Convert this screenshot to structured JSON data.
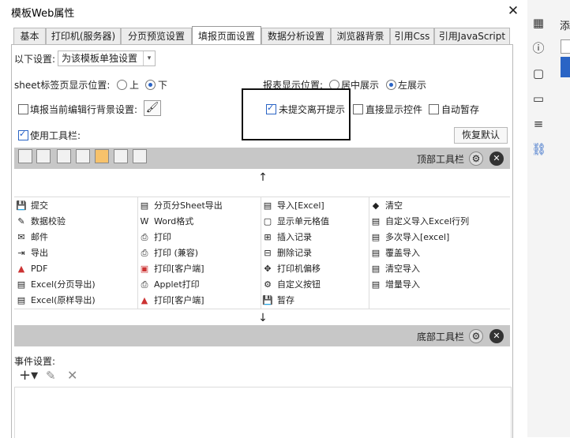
{
  "window": {
    "title": "模板Web属性"
  },
  "tabs": [
    "基本",
    "打印机(服务器)",
    "分页预览设置",
    "填报页面设置",
    "数据分析设置",
    "浏览器背景",
    "引用Css",
    "引用JavaScript"
  ],
  "settings": {
    "scope_label": "以下设置:",
    "scope_value": "为该模板单独设置",
    "sheet_pos_label": "sheet标签页显示位置:",
    "sheet_pos_top": "上",
    "sheet_pos_bottom": "下",
    "report_pos_label": "报表显示位置:",
    "report_pos_center": "居中展示",
    "report_pos_left": "左展示",
    "fill_bg_label": "填报当前编辑行背景设置:",
    "unsubmitted_label": "未提交离开提示",
    "direct_ctrl_label": "直接显示控件",
    "autosave_label": "自动暂存",
    "use_toolbar_label": "使用工具栏:",
    "restore_default": "恢复默认"
  },
  "top_toolbar_label": "顶部工具栏",
  "bottom_toolbar_label": "底部工具栏",
  "buttons": [
    [
      "提交",
      "分页分Sheet导出",
      "导入[Excel]",
      "清空"
    ],
    [
      "数据校验",
      "Word格式",
      "显示单元格值",
      "自定义导入Excel行列"
    ],
    [
      "邮件",
      "打印",
      "插入记录",
      "多次导入[excel]"
    ],
    [
      "导出",
      "打印 (兼容)",
      "删除记录",
      "覆盖导入"
    ],
    [
      "PDF",
      "打印[客户端]",
      "打印机偏移",
      "清空导入"
    ],
    [
      "Excel(分页导出)",
      "Applet打印",
      "自定义按钮",
      "增量导入"
    ],
    [
      "Excel(原样导出)",
      "打印[客户端]",
      "暂存",
      ""
    ]
  ],
  "events_label": "事件设置:",
  "right_panel": {
    "partial_text": "添"
  }
}
